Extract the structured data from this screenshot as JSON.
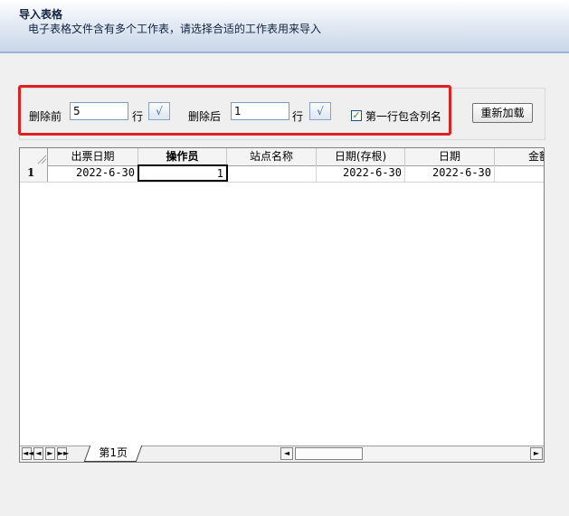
{
  "header": {
    "title": "导入表格",
    "subtitle": "电子表格文件含有多个工作表，请选择合适的工作表用来导入"
  },
  "toolbar": {
    "delete_before_label": "删除前",
    "delete_before_value": "5",
    "delete_before_unit": "行",
    "delete_after_label": "删除后",
    "delete_after_value": "1",
    "delete_after_unit": "行",
    "confirm_glyph": "√",
    "first_row_header_label": "第一行包含列名",
    "first_row_header_checked": true,
    "checkmark_glyph": "✓",
    "reload_label": "重新加载",
    "highlight_color": "#e02020"
  },
  "grid": {
    "columns": [
      "出票日期",
      "操作员",
      "站点名称",
      "日期(存根)",
      "日期",
      "金额"
    ],
    "rows": [
      {
        "index": "1",
        "cells": [
          "2022-6-30",
          "1",
          "",
          "2022-6-30",
          "2022-6-30",
          ""
        ]
      }
    ]
  },
  "sheet": {
    "tab_label": "第1页",
    "nav_first": "◄◄",
    "nav_prev": "◄",
    "nav_next": "►",
    "nav_last": "►►",
    "scroll_left": "◄",
    "scroll_right": "►"
  }
}
